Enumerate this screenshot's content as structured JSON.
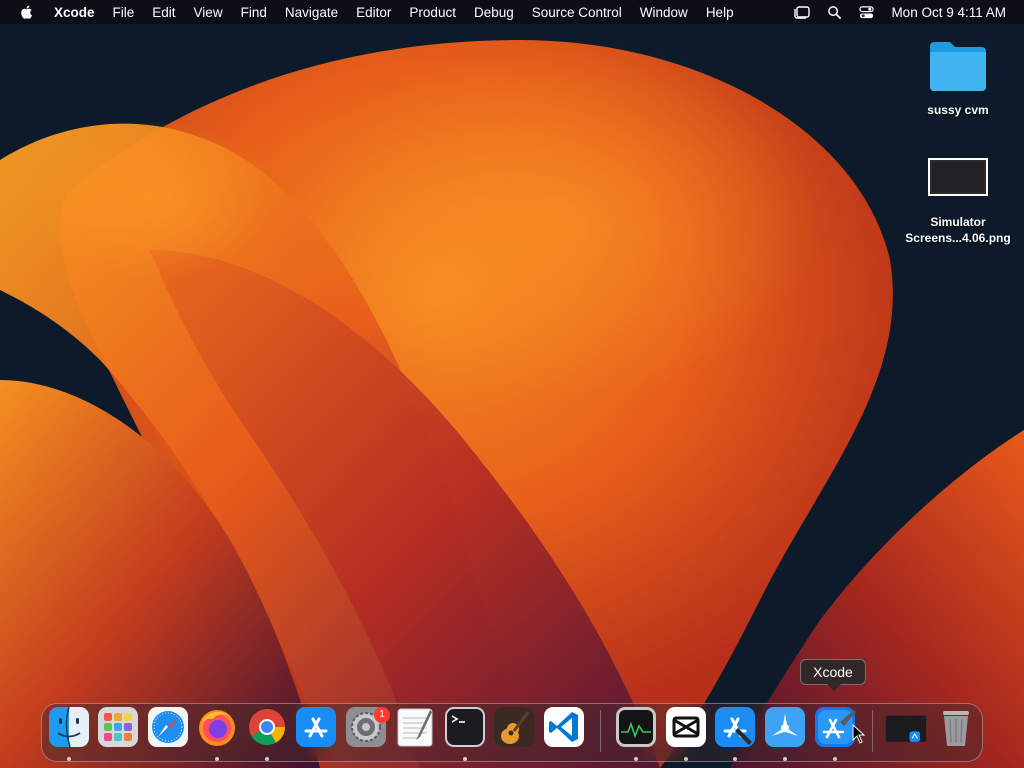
{
  "menubar": {
    "app_name": "Xcode",
    "menus": [
      "File",
      "Edit",
      "View",
      "Find",
      "Navigate",
      "Editor",
      "Product",
      "Debug",
      "Source Control",
      "Window",
      "Help"
    ],
    "status_icons": [
      "stage-manager-icon",
      "search-icon",
      "control-center-icon"
    ],
    "clock": "Mon Oct 9  4:11 AM"
  },
  "desktop": {
    "icons": [
      {
        "name": "folder",
        "label": "sussy cvm"
      },
      {
        "name": "screenshot-file",
        "label_line1": "Simulator",
        "label_line2": "Screens...4.06.png"
      }
    ]
  },
  "tooltip": {
    "text": "Xcode"
  },
  "dock": {
    "apps": [
      {
        "name": "finder-icon",
        "running": true
      },
      {
        "name": "launchpad-icon",
        "running": false
      },
      {
        "name": "safari-icon",
        "running": false
      },
      {
        "name": "firefox-icon",
        "running": true
      },
      {
        "name": "chrome-icon",
        "running": true
      },
      {
        "name": "app-store-icon",
        "running": false
      },
      {
        "name": "system-settings-icon",
        "running": false,
        "badge": "1"
      },
      {
        "name": "textedit-icon",
        "running": false
      },
      {
        "name": "terminal-icon",
        "running": true
      },
      {
        "name": "garageband-icon",
        "running": false
      },
      {
        "name": "vscode-icon",
        "running": false
      },
      {
        "name": "activity-monitor-icon",
        "running": true
      },
      {
        "name": "capcut-icon",
        "running": true
      },
      {
        "name": "xcode-alt-icon",
        "running": true
      },
      {
        "name": "testflight-icon",
        "running": true
      },
      {
        "name": "xcode-icon",
        "running": true
      },
      {
        "name": "minimized-window-icon",
        "running": false
      },
      {
        "name": "trash-icon",
        "running": false
      }
    ]
  },
  "colors": {
    "wallpaper_dark": "#0c1a2a",
    "wallpaper_orange": "#f07a1c",
    "wallpaper_red": "#c8301a",
    "wallpaper_purple": "#5a1a3a"
  }
}
